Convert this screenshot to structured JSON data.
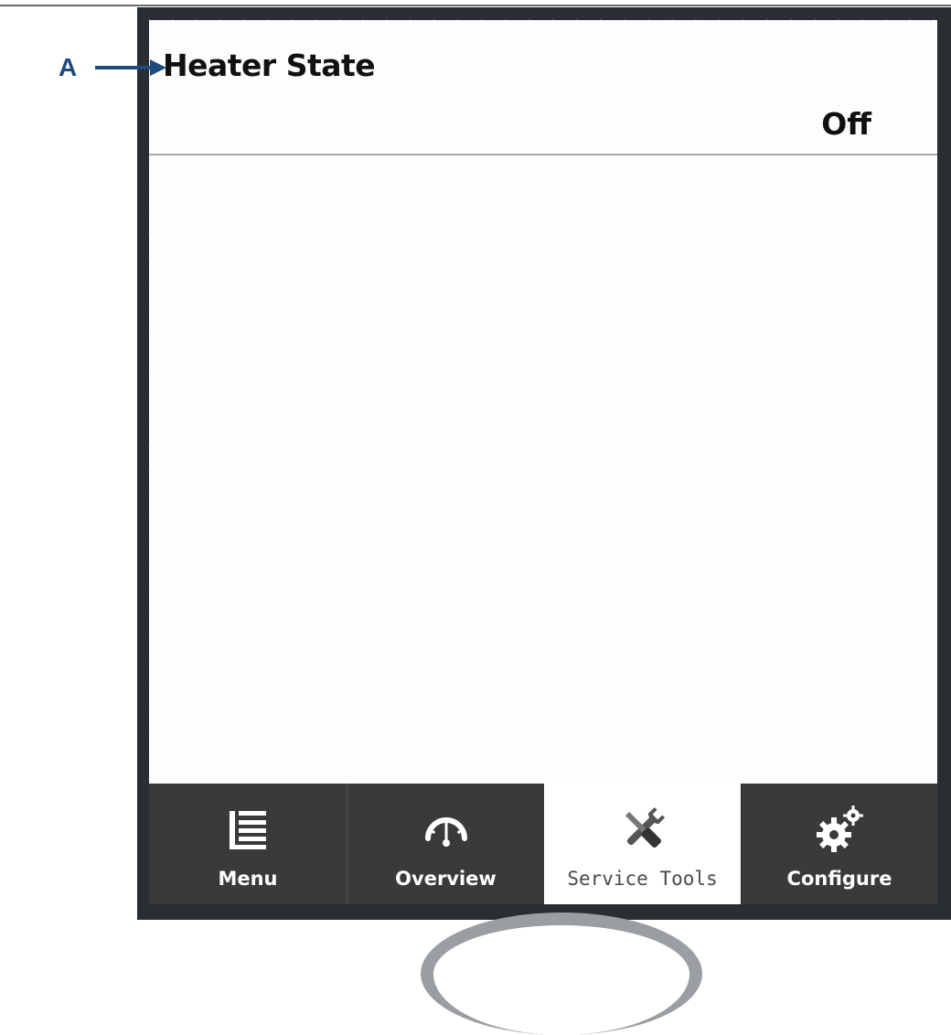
{
  "setting": {
    "label": "Heater State",
    "value": "Off"
  },
  "callout": {
    "letter": "A"
  },
  "nav": {
    "tabs": [
      {
        "label": "Menu",
        "icon": "menu-icon",
        "active": false
      },
      {
        "label": "Overview",
        "icon": "gauge-icon",
        "active": false
      },
      {
        "label": "Service Tools",
        "icon": "tools-icon",
        "active": true
      },
      {
        "label": "Configure",
        "icon": "gears-icon",
        "active": false
      }
    ]
  },
  "colors": {
    "device_frame": "#2a2d31",
    "tab_bg": "#3a3a3a",
    "active_tab_bg": "#ffffff",
    "callout": "#1e4a7e"
  }
}
